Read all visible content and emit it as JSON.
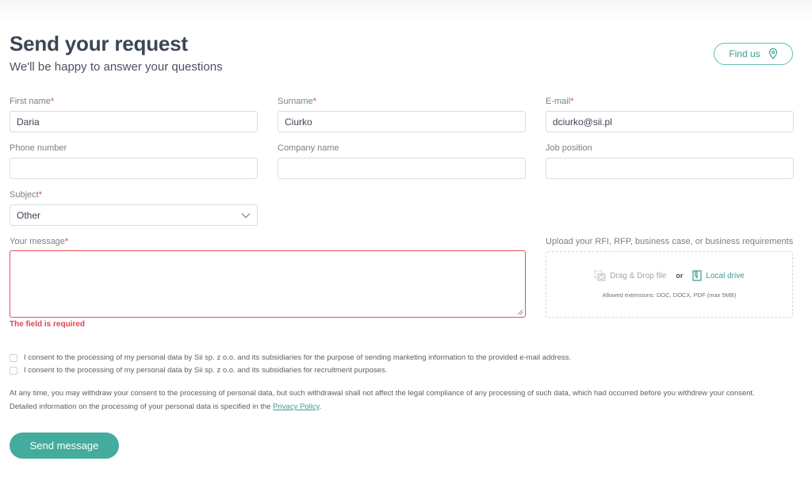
{
  "header": {
    "title": "Send your request",
    "subtitle": "We'll be happy to answer your questions",
    "find_us_label": "Find us",
    "find_us_icon": "map-pin-icon"
  },
  "form": {
    "required_marker": "*",
    "first_name": {
      "label": "First name",
      "value": "Daria",
      "required": true
    },
    "surname": {
      "label": "Surname",
      "value": "Ciurko",
      "required": true
    },
    "email": {
      "label": "E-mail",
      "value": "dciurko@sii.pl",
      "required": true
    },
    "phone": {
      "label": "Phone number",
      "value": "",
      "required": false
    },
    "company": {
      "label": "Company name",
      "value": "",
      "required": false
    },
    "job": {
      "label": "Job position",
      "value": "",
      "required": false
    },
    "subject": {
      "label": "Subject",
      "value": "Other",
      "required": true
    },
    "message": {
      "label": "Your message",
      "value": "",
      "required": true,
      "error": "The field is required"
    },
    "upload": {
      "label": "Upload your RFI, RFP, business case, or business requirements",
      "drag_drop": "Drag & Drop file",
      "or": "or",
      "local_drive": "Local drive",
      "allowed": "Allowed extensions: DOC, DOCX, PDF (max 5MB)"
    },
    "consents": [
      {
        "label": "I consent to the processing of my personal data by Sii sp. z o.o. and its subsidiaries for the purpose of sending marketing information to the provided e-mail address.",
        "checked": false
      },
      {
        "label": "I consent to the processing of my personal data by Sii sp. z o.o. and its subsidiaries for recruitment purposes.",
        "checked": false
      }
    ],
    "legal": {
      "line1": "At any time, you may withdraw your consent to the processing of personal data, but such withdrawal shall not affect the legal compliance of any processing of such data, which had occurred before you withdrew your consent.",
      "line2_prefix": "Detailed information on the processing of your personal data is specified in the ",
      "privacy_link": "Privacy Policy",
      "line2_suffix": "."
    },
    "submit_label": "Send message"
  },
  "colors": {
    "accent": "#43ac9c",
    "error": "#e0464e",
    "title": "#3c4655"
  }
}
